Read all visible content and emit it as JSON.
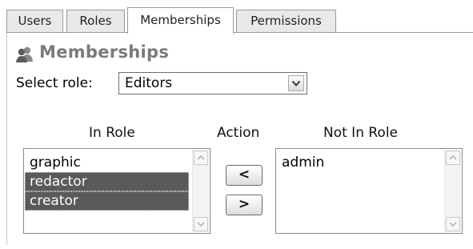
{
  "tabs": [
    {
      "label": "Users",
      "active": false
    },
    {
      "label": "Roles",
      "active": false
    },
    {
      "label": "Memberships",
      "active": true
    },
    {
      "label": "Permissions",
      "active": false
    }
  ],
  "section": {
    "title": "Memberships",
    "icon": "users-group-icon"
  },
  "select_role": {
    "label": "Select role:",
    "value": "Editors"
  },
  "columns": {
    "in_role": "In Role",
    "action": "Action",
    "not_in_role": "Not In Role"
  },
  "in_role_items": [
    {
      "label": "graphic",
      "selected": false
    },
    {
      "label": "redactor",
      "selected": true
    },
    {
      "label": "creator",
      "selected": true
    }
  ],
  "not_in_role_items": [
    {
      "label": "admin",
      "selected": false
    }
  ],
  "buttons": {
    "add": "<",
    "remove": ">"
  },
  "colors": {
    "selection": "#5a5a5a",
    "section_title": "#7a7a7a",
    "border": "#9a9a9a"
  }
}
